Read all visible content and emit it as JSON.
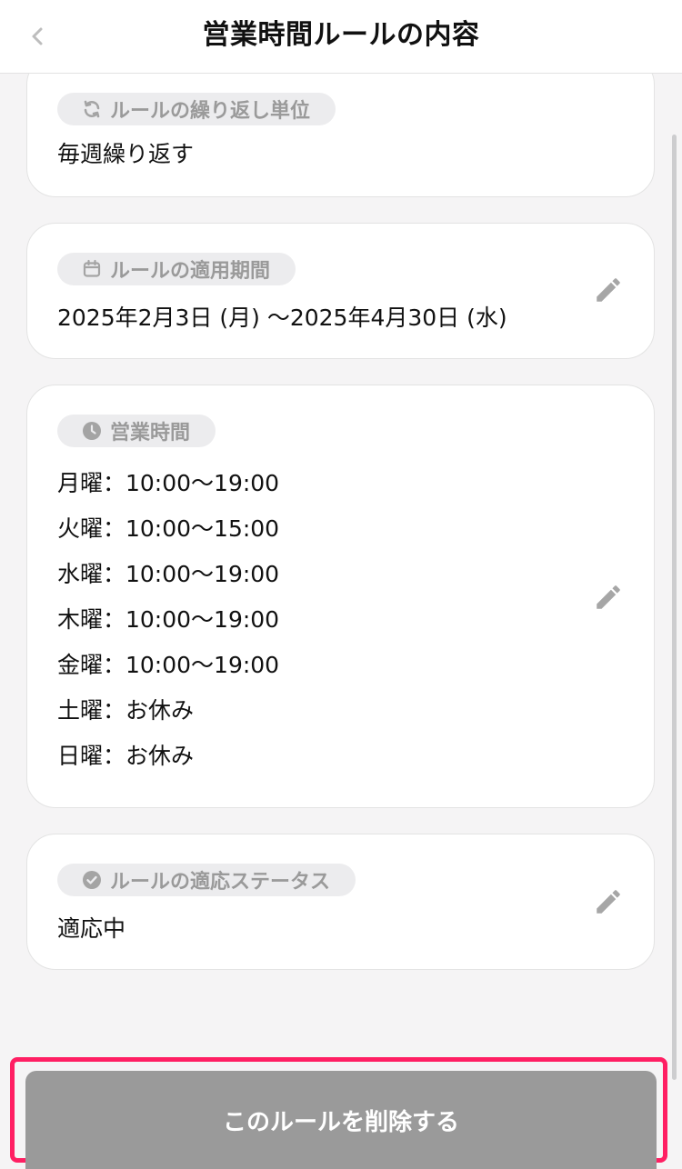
{
  "header": {
    "title": "営業時間ルールの内容",
    "back_icon": "chevron-left-icon"
  },
  "repeat_card": {
    "label": "ルールの繰り返し単位",
    "icon": "refresh-icon",
    "value": "毎週繰り返す"
  },
  "period_card": {
    "label": "ルールの適用期間",
    "icon": "calendar-icon",
    "value": "2025年2月3日 (月) ～2025年4月30日 (水)"
  },
  "hours_card": {
    "label": "営業時間",
    "icon": "clock-icon",
    "days": [
      "月曜：10:00～19:00",
      "火曜：10:00～15:00",
      "水曜：10:00～19:00",
      "木曜：10:00～19:00",
      "金曜：10:00～19:00",
      "土曜：お休み",
      "日曜：お休み"
    ]
  },
  "status_card": {
    "label": "ルールの適応ステータス",
    "icon": "check-circle-icon",
    "value": "適応中"
  },
  "actions": {
    "delete_label": "このルールを削除する",
    "edit_icon": "pencil-icon"
  },
  "colors": {
    "background": "#f5f4f5",
    "chip_background": "#ececee",
    "chip_text": "#9a9a9a",
    "delete_button": "#9a9a9a",
    "highlight_border": "#ff1f63"
  }
}
